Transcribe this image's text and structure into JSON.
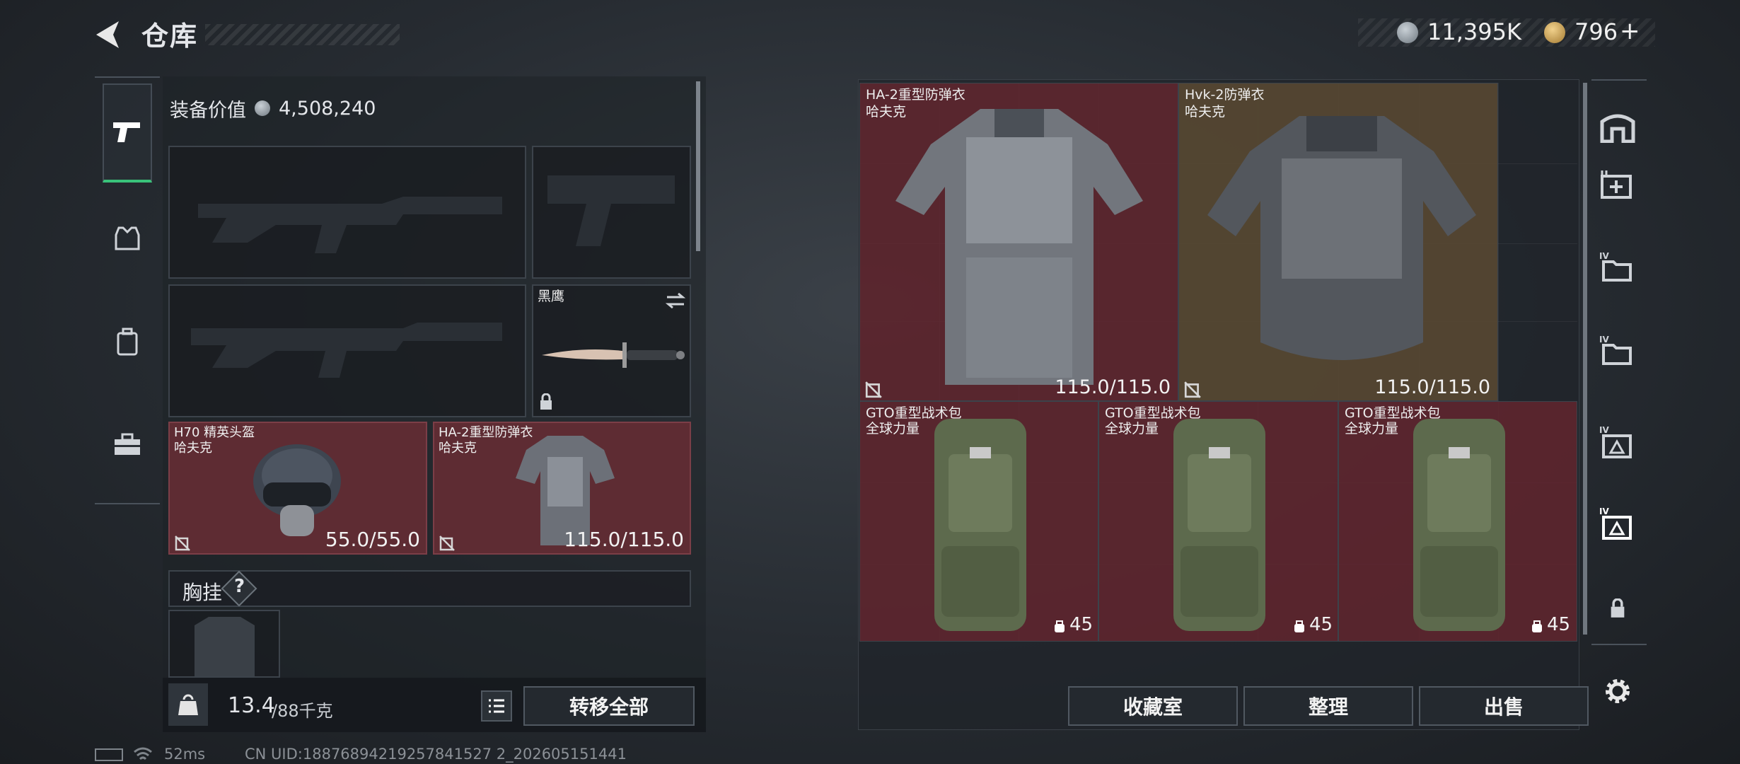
{
  "header": {
    "title": "仓库"
  },
  "currency": {
    "coins": "11,395K",
    "premium": "796",
    "plus": "+",
    "coin_color": "#9aa3ab",
    "premium_color": "#c8a25a"
  },
  "left": {
    "equip_value_label": "装备价值",
    "equip_value": "4,508,240",
    "knife": {
      "name": "黑鹰"
    },
    "helmet": {
      "name": "H70 精英头盔",
      "brand": "哈夫克",
      "durability": "55.0/55.0"
    },
    "armor": {
      "name": "HA-2重型防弹衣",
      "brand": "哈夫克",
      "durability": "115.0/115.0"
    },
    "chest_rig": {
      "label": "胸挂",
      "help": "?"
    },
    "weight": {
      "current": "13.4",
      "max": "/88千克"
    },
    "transfer_all": "转移全部"
  },
  "stash": {
    "items": [
      {
        "name": "HA-2重型防弹衣",
        "brand": "哈夫克",
        "durability": "115.0/115.0"
      },
      {
        "name": "Hvk-2防弹衣",
        "brand": "哈夫克",
        "durability": "115.0/115.0"
      },
      {
        "name": "GTO重型战术包",
        "brand": "全球力量",
        "capacity": "45"
      },
      {
        "name": "GTO重型战术包",
        "brand": "全球力量",
        "capacity": "45"
      },
      {
        "name": "GTO重型战术包",
        "brand": "全球力量",
        "capacity": "45"
      }
    ],
    "buttons": {
      "collection": "收藏室",
      "sort": "整理",
      "sell": "出售"
    }
  },
  "right_tabs": [
    "home-tab-icon",
    "medical-tab-icon",
    "folder-tab-icon",
    "folder-tab-icon",
    "ammo-tab-icon",
    "ammo-tab-active-icon",
    "lock-icon"
  ],
  "status_bar": {
    "ping": "52ms",
    "uid": "CN UID:18876894219257841527 2_202605151441"
  },
  "colors": {
    "accent_green": "#39c27a",
    "slot_red": "#5e2c33",
    "slot_gold": "#5e5038"
  }
}
